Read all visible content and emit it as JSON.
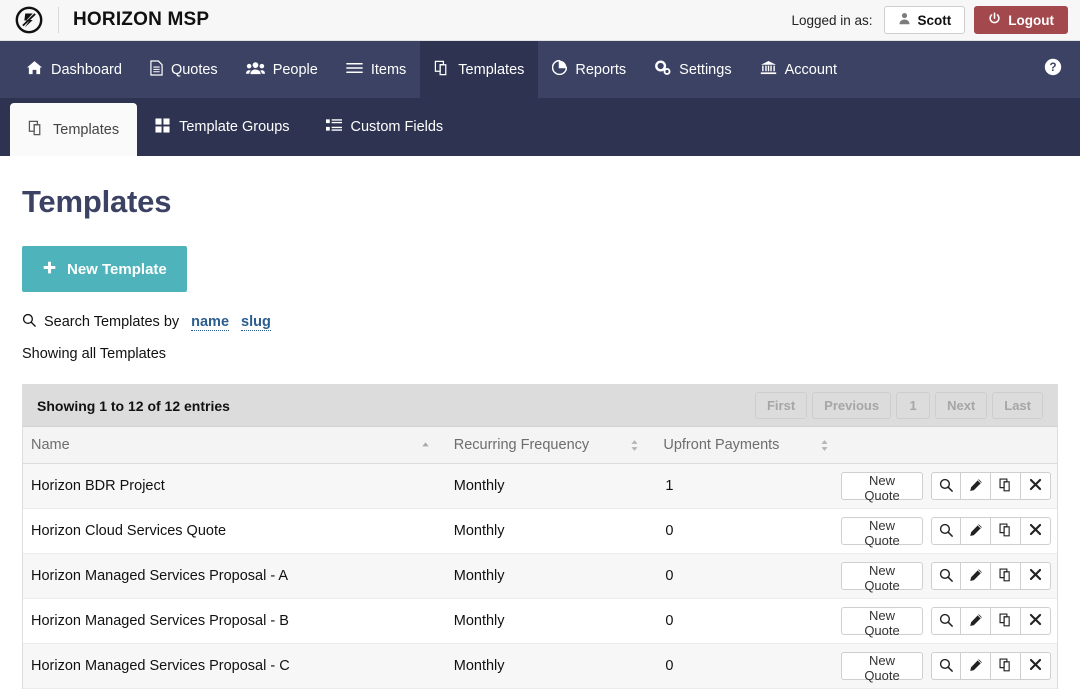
{
  "topbar": {
    "logo_icon": "horizon-circle-logo",
    "brand": "HORIZON MSP",
    "logged_in_label": "Logged in as:",
    "user_name": "Scott",
    "user_icon": "user-icon",
    "logout_label": "Logout",
    "logout_icon": "power-icon",
    "logout_color": "#a3484c"
  },
  "mainnav": {
    "background": "#3b4263",
    "active_background": "#2d3350",
    "items": [
      {
        "label": "Dashboard",
        "icon": "home-icon",
        "active": false
      },
      {
        "label": "Quotes",
        "icon": "document-icon",
        "active": false
      },
      {
        "label": "People",
        "icon": "users-icon",
        "active": false
      },
      {
        "label": "Items",
        "icon": "list-icon",
        "active": false
      },
      {
        "label": "Templates",
        "icon": "templates-icon",
        "active": true
      },
      {
        "label": "Reports",
        "icon": "pie-chart-icon",
        "active": false
      },
      {
        "label": "Settings",
        "icon": "gears-icon",
        "active": false
      },
      {
        "label": "Account",
        "icon": "bank-icon",
        "active": false
      }
    ],
    "help_icon": "help-circle-icon"
  },
  "subnav": {
    "background": "#2d3350",
    "items": [
      {
        "label": "Templates",
        "icon": "templates-icon",
        "active": true
      },
      {
        "label": "Template Groups",
        "icon": "grid-icon",
        "active": false
      },
      {
        "label": "Custom Fields",
        "icon": "list-ul-icon",
        "active": false
      }
    ]
  },
  "page": {
    "title": "Templates",
    "new_button_label": "New Template",
    "new_button_icon": "plus-icon",
    "new_button_color": "#4eb3ba",
    "search_icon": "search-icon",
    "search_prefix": "Search Templates by",
    "search_link_name": "name",
    "search_link_slug": "slug",
    "showing_all": "Showing all Templates"
  },
  "table": {
    "entries_label": "Showing 1 to 12 of 12 entries",
    "pager": [
      {
        "label": "First",
        "disabled": true
      },
      {
        "label": "Previous",
        "disabled": true
      },
      {
        "label": "1",
        "disabled": false
      },
      {
        "label": "Next",
        "disabled": true
      },
      {
        "label": "Last",
        "disabled": true
      }
    ],
    "columns": [
      {
        "label": "Name",
        "sort": "asc"
      },
      {
        "label": "Recurring Frequency",
        "sort": "none"
      },
      {
        "label": "Upfront Payments",
        "sort": "none"
      },
      {
        "label": "",
        "sort": null
      }
    ],
    "row_action_label": "New Quote",
    "row_action_icons": [
      "search-icon",
      "pencil-icon",
      "copy-icon",
      "close-x-icon"
    ],
    "rows": [
      {
        "name": "Horizon BDR Project",
        "frequency": "Monthly",
        "upfront": "1"
      },
      {
        "name": "Horizon Cloud Services Quote",
        "frequency": "Monthly",
        "upfront": "0"
      },
      {
        "name": "Horizon Managed Services Proposal - A",
        "frequency": "Monthly",
        "upfront": "0"
      },
      {
        "name": "Horizon Managed Services Proposal - B",
        "frequency": "Monthly",
        "upfront": "0"
      },
      {
        "name": "Horizon Managed Services Proposal - C",
        "frequency": "Monthly",
        "upfront": "0"
      }
    ]
  }
}
